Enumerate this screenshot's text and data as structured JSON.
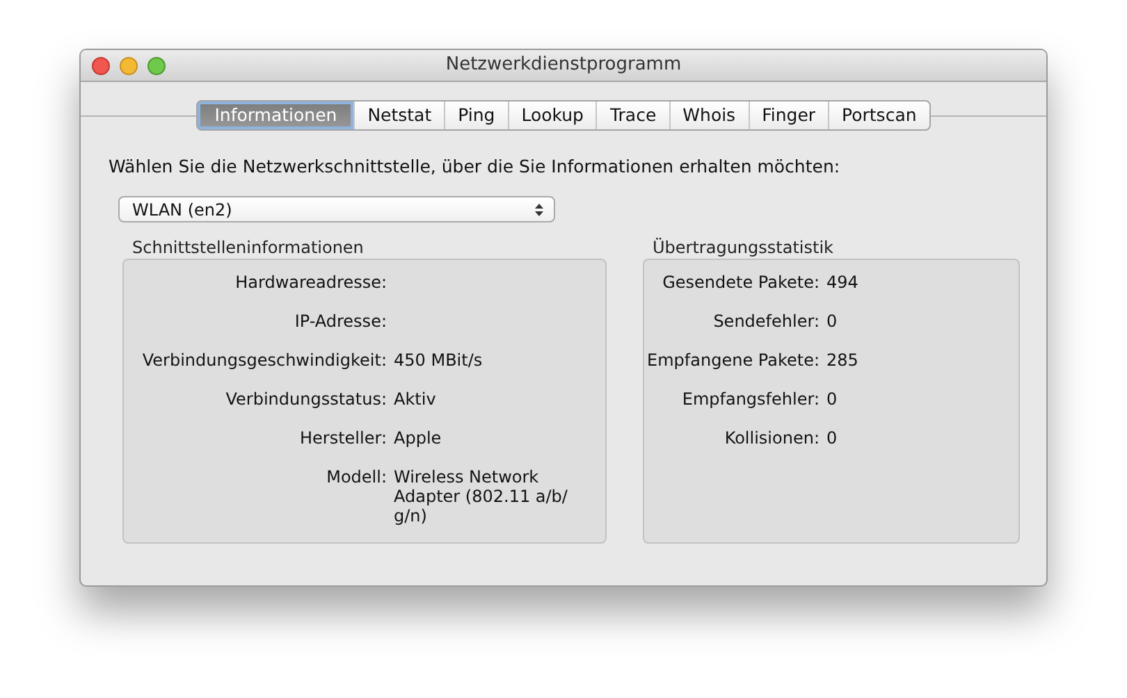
{
  "window": {
    "title": "Netzwerkdienstprogramm"
  },
  "tabs": [
    {
      "label": "Informationen",
      "selected": true
    },
    {
      "label": "Netstat",
      "selected": false
    },
    {
      "label": "Ping",
      "selected": false
    },
    {
      "label": "Lookup",
      "selected": false
    },
    {
      "label": "Trace",
      "selected": false
    },
    {
      "label": "Whois",
      "selected": false
    },
    {
      "label": "Finger",
      "selected": false
    },
    {
      "label": "Portscan",
      "selected": false
    }
  ],
  "prompt": "Wählen Sie die Netzwerkschnittstelle, über die Sie Informationen erhalten möchten:",
  "interface_select": {
    "value": "WLAN (en2)"
  },
  "interface_info": {
    "title": "Schnittstelleninformationen",
    "rows": [
      {
        "label": "Hardwareadresse:"
      },
      {
        "label": "IP-Adresse:"
      },
      {
        "label": "Verbindungsgeschwindigkeit:",
        "value": "450 MBit/s"
      },
      {
        "label": "Verbindungsstatus:",
        "value": "Aktiv"
      },
      {
        "label": "Hersteller:",
        "value": "Apple"
      },
      {
        "label": "Modell:",
        "value": "Wireless Network Adapter (802.11 a/b/ g/n)"
      }
    ]
  },
  "transfer_stats": {
    "title": "Übertragungsstatistik",
    "rows": [
      {
        "label": "Gesendete Pakete:",
        "value": "494"
      },
      {
        "label": "Sendefehler:",
        "value": "0"
      },
      {
        "label": "Empfangene Pakete:",
        "value": "285"
      },
      {
        "label": "Empfangsfehler:",
        "value": "0"
      },
      {
        "label": "Kollisionen:",
        "value": "0"
      }
    ]
  }
}
